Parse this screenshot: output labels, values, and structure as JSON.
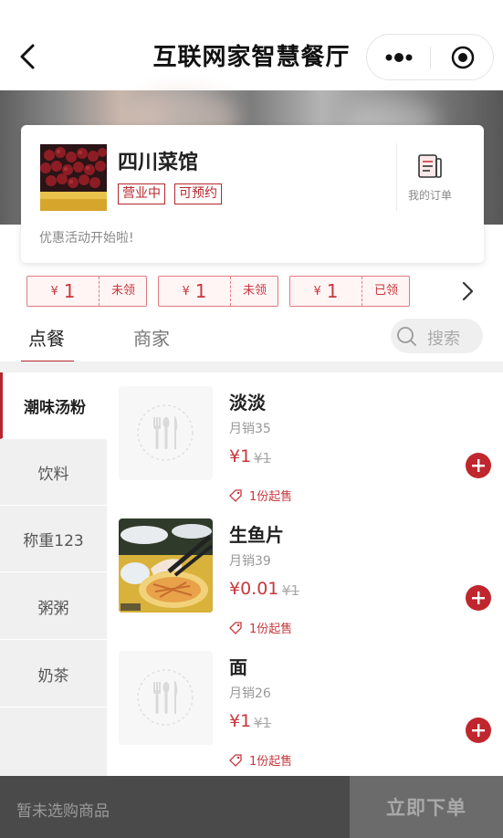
{
  "nav": {
    "title": "互联网家智慧餐厅"
  },
  "shop": {
    "name": "四川菜馆",
    "tags": [
      "营业中",
      "可预约"
    ],
    "my_orders_label": "我的订单",
    "promo": "优惠活动开始啦!"
  },
  "coupons": [
    {
      "currency": "¥",
      "amount": "1",
      "status": "未领"
    },
    {
      "currency": "¥",
      "amount": "1",
      "status": "未领"
    },
    {
      "currency": "¥",
      "amount": "1",
      "status": "已领"
    }
  ],
  "tabs": [
    {
      "label": "点餐",
      "active": true
    },
    {
      "label": "商家",
      "active": false
    }
  ],
  "search": {
    "placeholder": "搜索"
  },
  "categories": [
    {
      "label": "潮味汤粉",
      "active": true
    },
    {
      "label": "饮料",
      "active": false
    },
    {
      "label": "称重123",
      "active": false
    },
    {
      "label": "粥粥",
      "active": false
    },
    {
      "label": "奶茶",
      "active": false
    }
  ],
  "products": [
    {
      "name": "淡淡",
      "sales": "月销35",
      "price": "¥1",
      "original_price": "¥1",
      "min_qty": "1份起售",
      "image": "placeholder-cutlery"
    },
    {
      "name": "生鱼片",
      "sales": "月销39",
      "price": "¥0.01",
      "original_price": "¥1",
      "min_qty": "1份起售",
      "image": "photo-fish-dish"
    },
    {
      "name": "面",
      "sales": "月销26",
      "price": "¥1",
      "original_price": "¥1",
      "min_qty": "1份起售",
      "image": "placeholder-cutlery"
    }
  ],
  "cart": {
    "empty_text": "暂未选购商品",
    "checkout_label": "立即下单"
  },
  "colors": {
    "accent": "#b5272d",
    "bottom_bar": "#4a4a4a",
    "checkout_bg": "#6b6b6b"
  }
}
